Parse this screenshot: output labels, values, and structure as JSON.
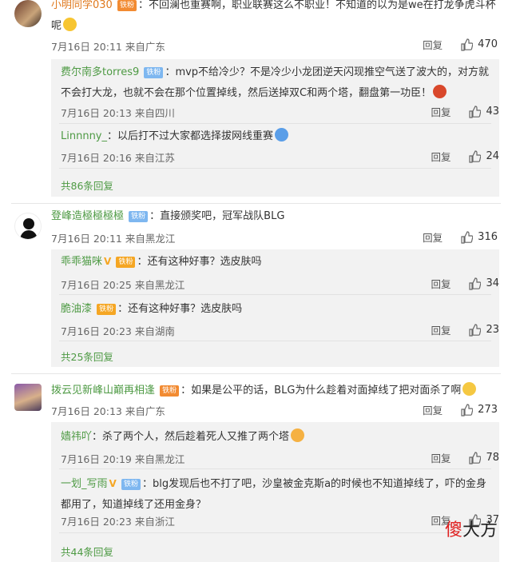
{
  "threads": [
    {
      "user": "小明同学030",
      "badge": "铁粉",
      "text": "：不回澜也重赛啊，职业联赛这么不职业！不知道的以为是we在打龙争虎斗杯呢",
      "time": "7月16日 20:11 来自广东",
      "reply_label": "回复",
      "likes": "470",
      "subs": [
        {
          "user": "费尔南多torres9",
          "badge": "铁粉",
          "text": "：mvp不给冷少？不是冷少小龙团逆天闪现推空气送了波大的，对方就不会打大龙，也就不会在那个位置掉线，然后送掉双C和两个塔，翻盘第一功臣！",
          "time": "7月16日 20:13 来自四川",
          "reply_label": "回复",
          "likes": "43"
        },
        {
          "user": "Linnnny_",
          "badge": "",
          "text": "：以后打不过大家都选择拔网线重赛",
          "time": "7月16日 20:16 来自江苏",
          "reply_label": "回复",
          "likes": "24"
        }
      ],
      "more": "共86条回复"
    },
    {
      "user": "登峰造極極極極",
      "badge": "铁粉",
      "text": "：直接颁奖吧，冠军战队BLG",
      "time": "7月16日 20:11 来自黑龙江",
      "reply_label": "回复",
      "likes": "316",
      "subs": [
        {
          "user": "乖乖猫咪",
          "badge": "铁粉",
          "text": "：还有这种好事？选皮肤吗",
          "time": "7月16日 20:25 来自黑龙江",
          "reply_label": "回复",
          "likes": "34"
        },
        {
          "user": "脆油漆",
          "badge": "铁粉",
          "text": "：还有这种好事？选皮肤吗",
          "time": "7月16日 20:23 来自湖南",
          "reply_label": "回复",
          "likes": "23"
        }
      ],
      "more": "共25条回复"
    },
    {
      "user": "拨云见新峰山巅再相逢",
      "badge": "铁粉",
      "text": "：如果是公平的话，BLG为什么趁着对面掉线了把对面杀了啊",
      "time": "7月16日 20:13 来自广东",
      "reply_label": "回复",
      "likes": "273",
      "subs": [
        {
          "user": "嫱祎吖",
          "badge": "",
          "text": "：杀了两个人，然后趁着死人又推了两个塔",
          "time": "7月16日 20:19 来自黑龙江",
          "reply_label": "回复",
          "likes": "78"
        },
        {
          "user": "一划_写雨",
          "badge": "铁粉",
          "text": "：blg发现后也不打了吧，沙皇被金克斯a的时候也不知道掉线了，吓的金身都用了，知道掉线了还用金身？",
          "time": "7月16日 20:23 来自浙江",
          "reply_label": "回复",
          "likes": "37"
        }
      ],
      "more": "共44条回复"
    }
  ],
  "watermark": {
    "part1": "傻",
    "part2": "大方"
  },
  "colors": {
    "username_orange": "#e07a1f",
    "username_green": "#4e9a44",
    "badge_blue": "#7eb7f0",
    "subbox_bg": "#f2f2f2"
  },
  "icons": [
    "thumbs-up-icon",
    "avatar",
    "emoji"
  ]
}
